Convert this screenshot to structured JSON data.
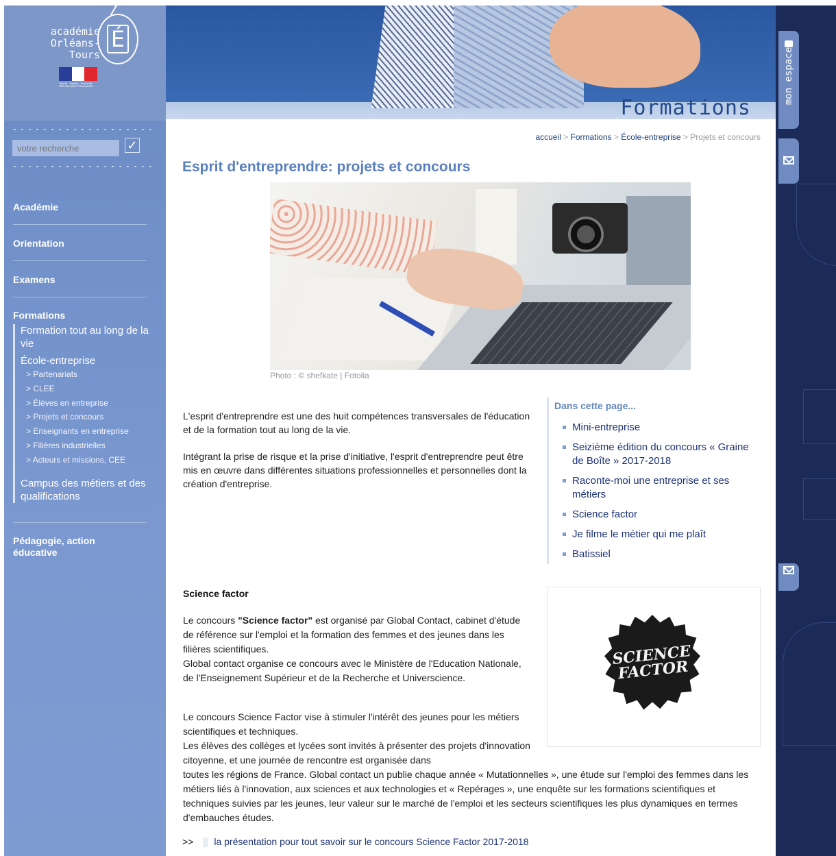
{
  "logo": {
    "line1": "académie",
    "line2": "Orléans-Tours",
    "letter": "É",
    "flag_caption": "Liberté · Égalité · Fraternité RÉPUBLIQUE FRANÇAISE"
  },
  "search": {
    "placeholder": "votre recherche",
    "submit_icon": "checkmark-icon"
  },
  "nav": {
    "items": [
      "Académie",
      "Orientation",
      "Examens",
      "Formations"
    ],
    "formations_sub": {
      "level1": [
        "Formation tout au long de la vie",
        "École-entreprise"
      ],
      "ecole_entreprise_items": [
        "> Partenariats",
        "> CLEE",
        "> Élèves en entreprise",
        "> Projets et concours",
        "> Enseignants en entreprise",
        "> Filières industrielles",
        "> Acteurs et missions, CEE"
      ],
      "campus": "Campus des métiers et des qualifications"
    },
    "last_item": "Pédagogie, action éducative"
  },
  "banner": {
    "title": "Formations"
  },
  "side_tabs": {
    "mon_espace": "mon espace",
    "lock_icon": "lock-icon",
    "mail_icon": "envelope-icon"
  },
  "breadcrumb": {
    "home": "accueil",
    "sep": " > ",
    "formations": "Formations",
    "ecole": "École-entreprise",
    "current": "Projets et concours"
  },
  "page": {
    "title": "Esprit d'entreprendre: projets et concours",
    "photo_credit": "Photo : © shefkate | Fotolia",
    "intro1": "L'esprit d'entreprendre est une des huit compétences transversales de l'éducation et de la formation tout au long de la vie.",
    "intro2": "Intégrant la prise de risque et la prise d'initiative, l'esprit d'entreprendre peut être mis en œuvre dans différentes situations professionnelles et personnelles dont la création d'entreprise."
  },
  "in_page": {
    "title": "Dans cette page...",
    "items": [
      "Mini-entreprise",
      "Seizième édition du concours « Graine de Boîte » 2017-2018",
      "Raconte-moi une entreprise et ses métiers",
      "Science factor",
      "Je filme le métier qui me plaît",
      "Batissiel"
    ]
  },
  "science_factor": {
    "heading": "Science factor",
    "p1_pre": "Le concours ",
    "p1_bold": "\"Science factor\"",
    "p1_post": " est organisé par Global Contact, cabinet d'étude de référence sur l'emploi et la formation des femmes et des jeunes dans les filières scientifiques.",
    "p1_line2": "Global contact organise ce concours avec le Ministère de l'Education Nationale, de l'Enseignement Supérieur et de la Recherche et Universcience.",
    "p2": "Le concours Science Factor vise à stimuler l'intérêt des jeunes pour les métiers scientifiques et techniques.",
    "p3a": "Les élèves des collèges et lycées sont invités à présenter des projets d'innovation citoyenne, et une journée de rencontre est organisée dans",
    "p3b": "toutes les régions de France. Global contact un publie chaque année « Mutationnelles », une étude sur l'emploi des femmes dans les métiers liés à l'innovation, aux sciences et aux technologies et « Repérages », une enquête sur les formations scientifiques et techniques suivies par les jeunes, leur valeur sur le marché de l'emploi et les secteurs scientifiques les plus dynamiques en termes d'embauches études.",
    "badge_line1": "SCIENCE",
    "badge_line2": "FACTOR",
    "more_arrow": ">>",
    "more_link": "la présentation pour tout savoir sur le concours Science Factor 2017-2018"
  }
}
